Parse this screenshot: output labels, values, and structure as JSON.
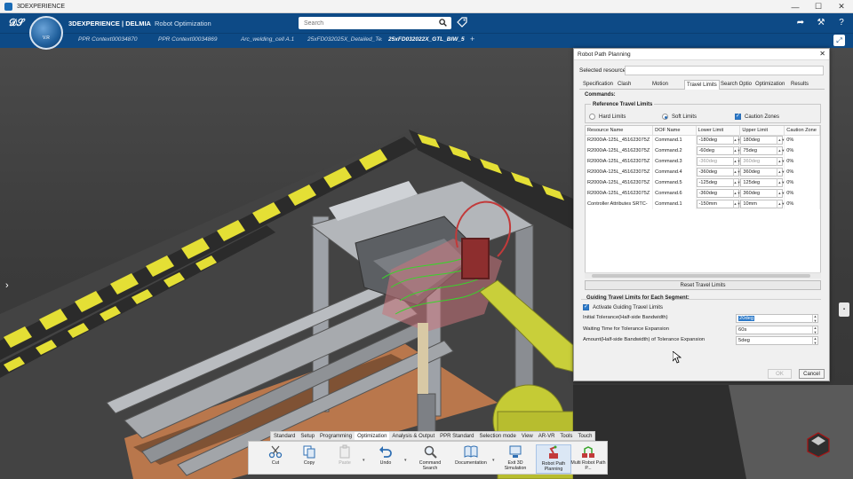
{
  "app": {
    "window_title": "3DEXPERIENCE"
  },
  "header": {
    "brand_main": "3DEXPERIENCE | DELMIA",
    "brand_sub": "Robot Optimization",
    "compass_label": "V.R",
    "search_placeholder": "Search"
  },
  "tabs": [
    {
      "label": "PPR Context00034870"
    },
    {
      "label": "PPR Context00034869"
    },
    {
      "label": "Arc_welding_cell A.1"
    },
    {
      "label": "25xFD032025X_Detailed_Test"
    },
    {
      "label": "25xFD032022X_GTL_BIW_5"
    }
  ],
  "dialog": {
    "title": "Robot Path Planning",
    "selected_resource_label": "Selected resource:",
    "selected_resource_value": "",
    "tabs": [
      "Specification",
      "Clash",
      "Motion",
      "Travel Limits",
      "Search Optio",
      "Optimization",
      "Results"
    ],
    "active_tab": "Travel Limits",
    "commands_label": "Commands:",
    "reference_title": "Reference Travel Limits",
    "hard_limits": "Hard Limits",
    "soft_limits": "Soft Limits",
    "caution_zones": "Caution Zones",
    "columns": [
      "Resource Name",
      "DOF Name",
      "Lower Limit",
      "Upper Limit",
      "Caution Zone"
    ],
    "rows": [
      {
        "resource": "R2000iA-125L_451623075Z",
        "dof": "Command.1",
        "lower": "-180deg",
        "upper": "180deg",
        "caution": "0%"
      },
      {
        "resource": "R2000iA-125L_451623075Z",
        "dof": "Command.2",
        "lower": "-60deg",
        "upper": "75deg",
        "caution": "0%"
      },
      {
        "resource": "R2000iA-125L_451623075Z",
        "dof": "Command.3",
        "lower": "-360deg",
        "upper": "360deg",
        "caution": "0%"
      },
      {
        "resource": "R2000iA-125L_451623075Z",
        "dof": "Command.4",
        "lower": "-360deg",
        "upper": "360deg",
        "caution": "0%"
      },
      {
        "resource": "R2000iA-125L_451623075Z",
        "dof": "Command.5",
        "lower": "-125deg",
        "upper": "125deg",
        "caution": "0%"
      },
      {
        "resource": "R2000iA-125L_451623075Z",
        "dof": "Command.6",
        "lower": "-360deg",
        "upper": "360deg",
        "caution": "0%"
      },
      {
        "resource": "Controller Attributes SRTC-",
        "dof": "Command.1",
        "lower": "-150mm",
        "upper": "10mm",
        "caution": "0%"
      }
    ],
    "reset_label": "Reset Travel Limits",
    "guiding_title": "Guiding Travel Limits for Each Segment:",
    "activate_label": "Activate Guiding Travel Limits",
    "initial_tolerance_label": "Initial Tolerance(Half-side Bandwidth)",
    "initial_tolerance_value": "20deg",
    "waiting_time_label": "Waiting Time for Tolerance Expansion",
    "waiting_time_value": "60s",
    "amount_label": "Amount(Half-side Bandwidth) of Tolerance Expansion",
    "amount_value": "5deg",
    "ok_label": "OK",
    "cancel_label": "Cancel"
  },
  "action_tabs": [
    "Standard",
    "Setup",
    "Programming",
    "Optimization",
    "Analysis & Output",
    "PPR Standard",
    "Selection mode",
    "View",
    "AR-VR",
    "Tools",
    "Touch"
  ],
  "active_action_tab": "Optimization",
  "action_buttons": [
    {
      "label": "Cut"
    },
    {
      "label": "Copy"
    },
    {
      "label": "Paste"
    },
    {
      "label": "Undo"
    },
    {
      "label": "Command Search"
    },
    {
      "label": "Documentation"
    },
    {
      "label": "Exit 3D Simulation"
    },
    {
      "label": "Robot Path Planning"
    },
    {
      "label": "Multi Robot Path P..."
    }
  ],
  "colors": {
    "accent": "#0d4a86",
    "hazard_yellow": "#e9e233",
    "robot_yellow": "#c9cf3a",
    "selection": "#2a78c8"
  }
}
